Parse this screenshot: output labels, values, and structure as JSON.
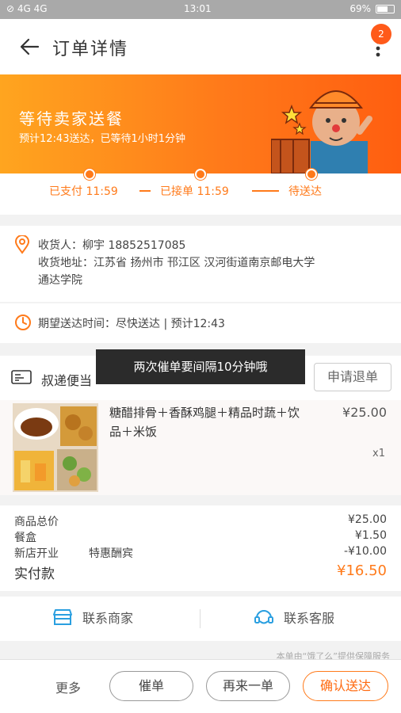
{
  "status_bar": {
    "left": "⊘ 4G 4G",
    "time": "13:01",
    "right": "69%"
  },
  "nav": {
    "title": "订单详情",
    "badge": "2"
  },
  "banner": {
    "headline": "等待卖家送餐",
    "subtitle": "预计12:43送达，已等待1小时1分钟"
  },
  "progress": {
    "steps": [
      "已支付 11:59",
      "已接单 11:59",
      "待送达"
    ]
  },
  "address": {
    "receiver": "收货人：柳宇 18852517085",
    "line1": "收货地址：江苏省 扬州市 邗江区 汉河街道南京邮电大学",
    "line2": "通达学院"
  },
  "eta": {
    "text": "期望送达时间：尽快送达 | 预计12:43"
  },
  "shop": {
    "name": "叔递便当",
    "refund_label": "申请退单"
  },
  "toast": {
    "text": "两次催单要间隔10分钟哦"
  },
  "item": {
    "name": "糖醋排骨＋香酥鸡腿＋精品时蔬＋饮品＋米饭",
    "price": "¥25.00",
    "qty": "x1"
  },
  "summary": {
    "goods_label": "商品总价",
    "goods_value": "¥25.00",
    "box_label": "餐盒",
    "box_value": "¥1.50",
    "promo_label": "新店开业",
    "promo_tag": "特惠酬宾",
    "promo_value": "-¥10.00",
    "total_label": "实付款",
    "total_value": "¥16.50"
  },
  "contact": {
    "merchant": "联系商家",
    "service": "联系客服"
  },
  "footnote": "本单由“饿了么”提供保障服务",
  "bottom_bar": {
    "more": "更多",
    "urge": "催单",
    "reorder": "再来一单",
    "confirm": "确认送达"
  },
  "colors": {
    "accent": "#ff7a1a",
    "banner_start": "#ffa51f",
    "banner_end": "#ff5e10",
    "toast_bg": "#2b2b2b"
  }
}
